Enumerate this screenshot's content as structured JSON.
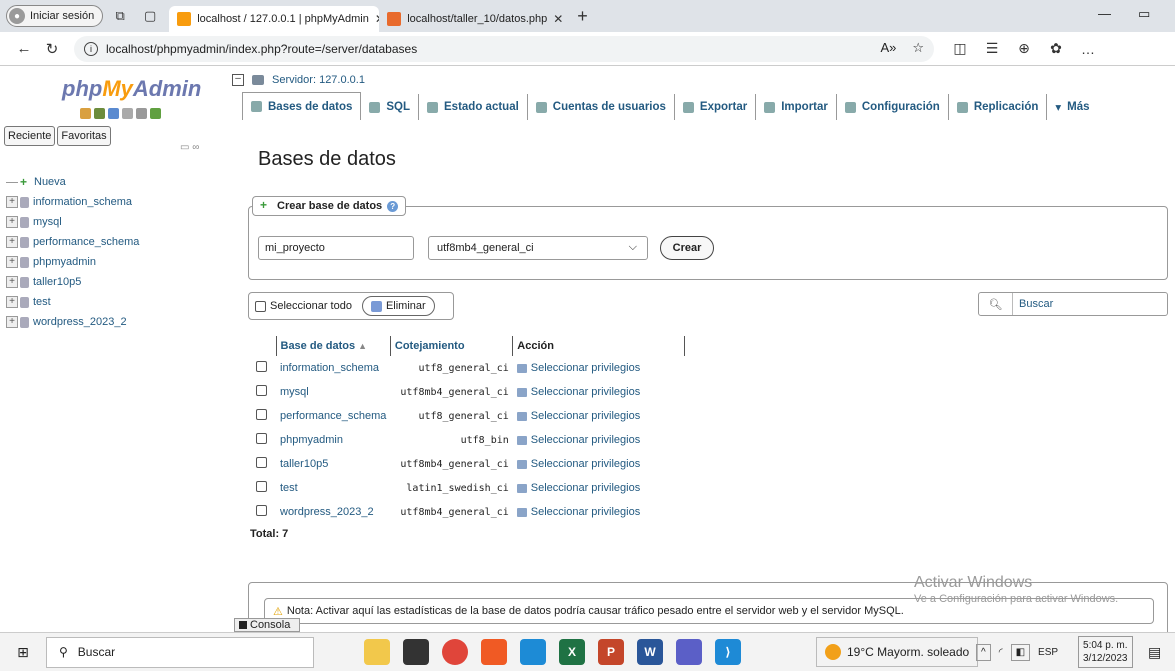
{
  "browser": {
    "signin": "Iniciar sesión",
    "tabs": [
      {
        "label": "localhost / 127.0.0.1 | phpMyAdmin",
        "active": true
      },
      {
        "label": "localhost/taller_10/datos.php",
        "active": false
      }
    ],
    "url": "localhost/phpmyadmin/index.php?route=/server/databases"
  },
  "sidebar": {
    "logo": {
      "php": "php",
      "my": "My",
      "admin": "Admin"
    },
    "buttons": [
      "Reciente",
      "Favoritas"
    ],
    "new_label": "Nueva",
    "databases": [
      "information_schema",
      "mysql",
      "performance_schema",
      "phpmyadmin",
      "taller10p5",
      "test",
      "wordpress_2023_2"
    ]
  },
  "server": {
    "label": "Servidor: 127.0.0.1"
  },
  "menu": [
    {
      "label": "Bases de datos",
      "icon": "database-icon"
    },
    {
      "label": "SQL",
      "icon": "sql-icon"
    },
    {
      "label": "Estado actual",
      "icon": "status-icon"
    },
    {
      "label": "Cuentas de usuarios",
      "icon": "users-icon"
    },
    {
      "label": "Exportar",
      "icon": "export-icon"
    },
    {
      "label": "Importar",
      "icon": "import-icon"
    },
    {
      "label": "Configuración",
      "icon": "wrench-icon"
    },
    {
      "label": "Replicación",
      "icon": "replication-icon"
    },
    {
      "label": "Más",
      "icon": "chevron-down-icon"
    }
  ],
  "page": {
    "title": "Bases de datos",
    "create": {
      "legend": "Crear base de datos",
      "name_value": "mi_proyecto",
      "collation_value": "utf8mb4_general_ci",
      "button": "Crear"
    },
    "select_all": "Seleccionar todo",
    "delete": "Eliminar",
    "search": "Buscar",
    "table": {
      "headers": [
        "Base de datos",
        "Cotejamiento",
        "Acción"
      ],
      "rows": [
        {
          "name": "information_schema",
          "collation": "utf8_general_ci",
          "action": "Seleccionar privilegios"
        },
        {
          "name": "mysql",
          "collation": "utf8mb4_general_ci",
          "action": "Seleccionar privilegios"
        },
        {
          "name": "performance_schema",
          "collation": "utf8_general_ci",
          "action": "Seleccionar privilegios"
        },
        {
          "name": "phpmyadmin",
          "collation": "utf8_bin",
          "action": "Seleccionar privilegios"
        },
        {
          "name": "taller10p5",
          "collation": "utf8mb4_general_ci",
          "action": "Seleccionar privilegios"
        },
        {
          "name": "test",
          "collation": "latin1_swedish_ci",
          "action": "Seleccionar privilegios"
        },
        {
          "name": "wordpress_2023_2",
          "collation": "utf8mb4_general_ci",
          "action": "Seleccionar privilegios"
        }
      ]
    },
    "total": "Total: 7",
    "note": "Nota: Activar aquí las estadísticas de la base de datos podría causar tráfico pesado entre el servidor web y el servidor MySQL.",
    "console": "Consola"
  },
  "windows_watermark": {
    "line1": "Activar Windows",
    "line2": "Ve a Configuración para activar Windows."
  },
  "taskbar": {
    "search": "Buscar",
    "weather": "19°C  Mayorm. soleado",
    "lang": "ESP",
    "time": "5:04 p. m.",
    "date": "3/12/2023"
  }
}
